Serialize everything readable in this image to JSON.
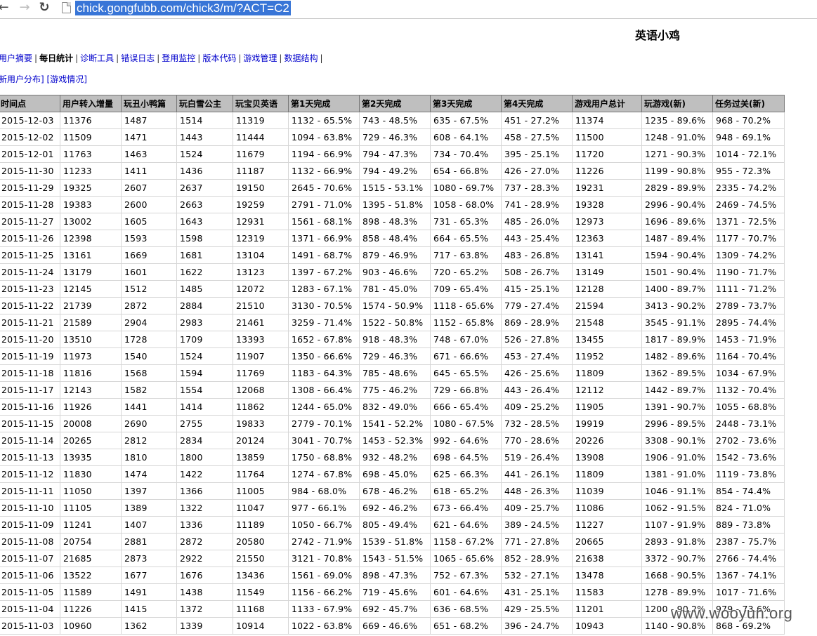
{
  "browser": {
    "url": "chick.gongfubb.com/chick3/m/?ACT=C2"
  },
  "site": {
    "title": "英语小鸡"
  },
  "menu": [
    {
      "label": "用户摘要",
      "active": false
    },
    {
      "label": "每日统计",
      "active": true
    },
    {
      "label": "诊断工具",
      "active": false
    },
    {
      "label": "错误日志",
      "active": false
    },
    {
      "label": "登用监控",
      "active": false
    },
    {
      "label": "版本代码",
      "active": false
    },
    {
      "label": "游戏管理",
      "active": false
    },
    {
      "label": "数据结构",
      "active": false
    }
  ],
  "submenu": {
    "items": [
      "新用户分布]",
      "[游戏情况]"
    ]
  },
  "table": {
    "headers": [
      "时间点",
      "用户转入增量",
      "玩丑小鸭篇",
      "玩白雪公主",
      "玩宝贝英语",
      "第1天完成",
      "第2天完成",
      "第3天完成",
      "第4天完成",
      "游戏用户总计",
      "玩游戏(新)",
      "任务过关(新)"
    ],
    "rows": [
      [
        "2015-12-03",
        "11376",
        "1487",
        "1514",
        "11319",
        "1132 - 65.5%",
        "743 - 48.5%",
        "635 - 67.5%",
        "451 - 27.2%",
        "11374",
        "1235 - 89.6%",
        "968 - 70.2%"
      ],
      [
        "2015-12-02",
        "11509",
        "1471",
        "1443",
        "11444",
        "1094 - 63.8%",
        "729 - 46.3%",
        "608 - 64.1%",
        "458 - 27.5%",
        "11500",
        "1248 - 91.0%",
        "948 - 69.1%"
      ],
      [
        "2015-12-01",
        "11763",
        "1463",
        "1524",
        "11679",
        "1194 - 66.9%",
        "794 - 47.3%",
        "734 - 70.4%",
        "395 - 25.1%",
        "11720",
        "1271 - 90.3%",
        "1014 - 72.1%"
      ],
      [
        "2015-11-30",
        "11233",
        "1411",
        "1436",
        "11187",
        "1132 - 66.9%",
        "794 - 49.2%",
        "654 - 66.8%",
        "426 - 27.0%",
        "11226",
        "1199 - 90.8%",
        "955 - 72.3%"
      ],
      [
        "2015-11-29",
        "19325",
        "2607",
        "2637",
        "19150",
        "2645 - 70.6%",
        "1515 - 53.1%",
        "1080 - 69.7%",
        "737 - 28.3%",
        "19231",
        "2829 - 89.9%",
        "2335 - 74.2%"
      ],
      [
        "2015-11-28",
        "19383",
        "2600",
        "2663",
        "19259",
        "2791 - 71.0%",
        "1395 - 51.8%",
        "1058 - 68.0%",
        "741 - 28.9%",
        "19328",
        "2996 - 90.4%",
        "2469 - 74.5%"
      ],
      [
        "2015-11-27",
        "13002",
        "1605",
        "1643",
        "12931",
        "1561 - 68.1%",
        "898 - 48.3%",
        "731 - 65.3%",
        "485 - 26.0%",
        "12973",
        "1696 - 89.6%",
        "1371 - 72.5%"
      ],
      [
        "2015-11-26",
        "12398",
        "1593",
        "1598",
        "12319",
        "1371 - 66.9%",
        "858 - 48.4%",
        "664 - 65.5%",
        "443 - 25.4%",
        "12363",
        "1487 - 89.4%",
        "1177 - 70.7%"
      ],
      [
        "2015-11-25",
        "13161",
        "1669",
        "1681",
        "13104",
        "1491 - 68.7%",
        "879 - 46.9%",
        "717 - 63.8%",
        "483 - 26.8%",
        "13141",
        "1594 - 90.4%",
        "1309 - 74.2%"
      ],
      [
        "2015-11-24",
        "13179",
        "1601",
        "1622",
        "13123",
        "1397 - 67.2%",
        "903 - 46.6%",
        "720 - 65.2%",
        "508 - 26.7%",
        "13149",
        "1501 - 90.4%",
        "1190 - 71.7%"
      ],
      [
        "2015-11-23",
        "12145",
        "1512",
        "1485",
        "12072",
        "1283 - 67.1%",
        "781 - 45.0%",
        "709 - 65.4%",
        "415 - 25.1%",
        "12128",
        "1400 - 89.7%",
        "1111 - 71.2%"
      ],
      [
        "2015-11-22",
        "21739",
        "2872",
        "2884",
        "21510",
        "3130 - 70.5%",
        "1574 - 50.9%",
        "1118 - 65.6%",
        "779 - 27.4%",
        "21594",
        "3413 - 90.2%",
        "2789 - 73.7%"
      ],
      [
        "2015-11-21",
        "21589",
        "2904",
        "2983",
        "21461",
        "3259 - 71.4%",
        "1522 - 50.8%",
        "1152 - 65.8%",
        "869 - 28.9%",
        "21548",
        "3545 - 91.1%",
        "2895 - 74.4%"
      ],
      [
        "2015-11-20",
        "13510",
        "1728",
        "1709",
        "13393",
        "1652 - 67.8%",
        "918 - 48.3%",
        "748 - 67.0%",
        "526 - 27.8%",
        "13455",
        "1817 - 89.9%",
        "1453 - 71.9%"
      ],
      [
        "2015-11-19",
        "11973",
        "1540",
        "1524",
        "11907",
        "1350 - 66.6%",
        "729 - 46.3%",
        "671 - 66.6%",
        "453 - 27.4%",
        "11952",
        "1482 - 89.6%",
        "1164 - 70.4%"
      ],
      [
        "2015-11-18",
        "11816",
        "1568",
        "1594",
        "11769",
        "1183 - 64.3%",
        "785 - 48.6%",
        "645 - 65.5%",
        "426 - 25.6%",
        "11809",
        "1362 - 89.5%",
        "1034 - 67.9%"
      ],
      [
        "2015-11-17",
        "12143",
        "1582",
        "1554",
        "12068",
        "1308 - 66.4%",
        "775 - 46.2%",
        "729 - 66.8%",
        "443 - 26.4%",
        "12112",
        "1442 - 89.7%",
        "1132 - 70.4%"
      ],
      [
        "2015-11-16",
        "11926",
        "1441",
        "1414",
        "11862",
        "1244 - 65.0%",
        "832 - 49.0%",
        "666 - 65.4%",
        "409 - 25.2%",
        "11905",
        "1391 - 90.7%",
        "1055 - 68.8%"
      ],
      [
        "2015-11-15",
        "20008",
        "2690",
        "2755",
        "19833",
        "2779 - 70.1%",
        "1541 - 52.2%",
        "1080 - 67.5%",
        "732 - 28.5%",
        "19919",
        "2996 - 89.5%",
        "2448 - 73.1%"
      ],
      [
        "2015-11-14",
        "20265",
        "2812",
        "2834",
        "20124",
        "3041 - 70.7%",
        "1453 - 52.3%",
        "992 - 64.6%",
        "770 - 28.6%",
        "20226",
        "3308 - 90.1%",
        "2702 - 73.6%"
      ],
      [
        "2015-11-13",
        "13935",
        "1810",
        "1800",
        "13859",
        "1750 - 68.8%",
        "932 - 48.2%",
        "698 - 64.5%",
        "519 - 26.4%",
        "13908",
        "1906 - 91.0%",
        "1542 - 73.6%"
      ],
      [
        "2015-11-12",
        "11830",
        "1474",
        "1422",
        "11764",
        "1274 - 67.8%",
        "698 - 45.0%",
        "625 - 66.3%",
        "441 - 26.1%",
        "11809",
        "1381 - 91.0%",
        "1119 - 73.8%"
      ],
      [
        "2015-11-11",
        "11050",
        "1397",
        "1366",
        "11005",
        "984 - 68.0%",
        "678 - 46.2%",
        "618 - 65.2%",
        "448 - 26.3%",
        "11039",
        "1046 - 91.1%",
        "854 - 74.4%"
      ],
      [
        "2015-11-10",
        "11105",
        "1389",
        "1322",
        "11047",
        "977 - 66.1%",
        "692 - 46.2%",
        "673 - 66.4%",
        "409 - 25.7%",
        "11086",
        "1062 - 91.5%",
        "824 - 71.0%"
      ],
      [
        "2015-11-09",
        "11241",
        "1407",
        "1336",
        "11189",
        "1050 - 66.7%",
        "805 - 49.4%",
        "621 - 64.6%",
        "389 - 24.5%",
        "11227",
        "1107 - 91.9%",
        "889 - 73.8%"
      ],
      [
        "2015-11-08",
        "20754",
        "2881",
        "2872",
        "20580",
        "2742 - 71.9%",
        "1539 - 51.8%",
        "1158 - 67.2%",
        "771 - 27.8%",
        "20665",
        "2893 - 91.8%",
        "2387 - 75.7%"
      ],
      [
        "2015-11-07",
        "21685",
        "2873",
        "2922",
        "21550",
        "3121 - 70.8%",
        "1543 - 51.5%",
        "1065 - 65.6%",
        "852 - 28.9%",
        "21638",
        "3372 - 90.7%",
        "2766 - 74.4%"
      ],
      [
        "2015-11-06",
        "13522",
        "1677",
        "1676",
        "13436",
        "1561 - 69.0%",
        "898 - 47.3%",
        "752 - 67.3%",
        "532 - 27.1%",
        "13478",
        "1668 - 90.5%",
        "1367 - 74.1%"
      ],
      [
        "2015-11-05",
        "11589",
        "1491",
        "1438",
        "11549",
        "1156 - 66.2%",
        "719 - 45.6%",
        "601 - 64.6%",
        "431 - 25.1%",
        "11583",
        "1278 - 89.9%",
        "1017 - 71.6%"
      ],
      [
        "2015-11-04",
        "11226",
        "1415",
        "1372",
        "11168",
        "1133 - 67.9%",
        "692 - 45.7%",
        "636 - 68.5%",
        "429 - 25.5%",
        "11201",
        "1200 - 90.2%",
        "979 - 73.6%"
      ],
      [
        "2015-11-03",
        "10960",
        "1362",
        "1339",
        "10914",
        "1022 - 63.8%",
        "669 - 46.6%",
        "651 - 68.2%",
        "396 - 24.7%",
        "10943",
        "1140 - 90.8%",
        "868 - 69.2%"
      ]
    ]
  },
  "watermark": "www.wooyun.org",
  "colors": {
    "link": "#0000cc",
    "header_bg": "#bfbfbf",
    "url_highlight": "#3875d7"
  }
}
